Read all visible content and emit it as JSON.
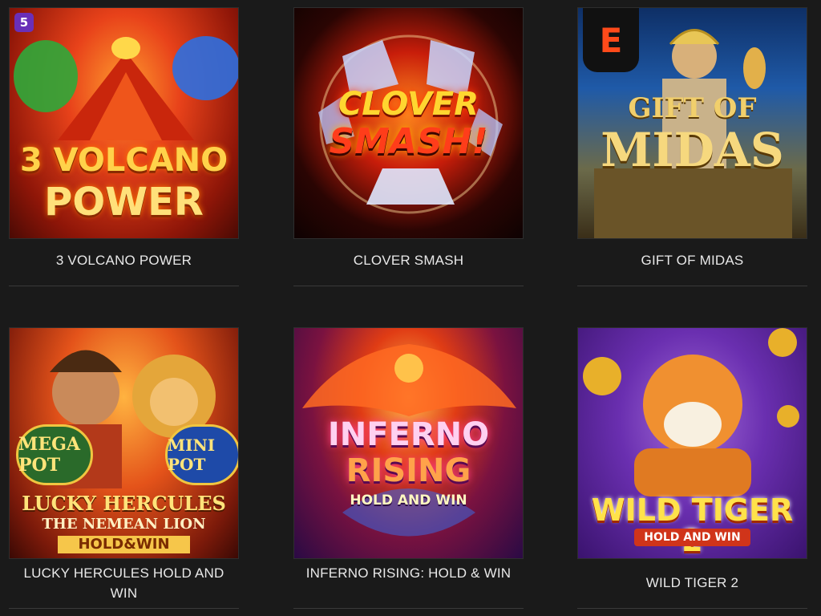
{
  "games": [
    {
      "id": "volcano",
      "label": "3 VOLCANO POWER",
      "art_lines": [
        "3 VOLCANO",
        "POWER"
      ],
      "provider_badge": "5",
      "accent": "#e8421a"
    },
    {
      "id": "clover",
      "label": "CLOVER SMASH",
      "art_lines": [
        "CLOVER",
        "SMASH!"
      ],
      "accent": "#c81d0a"
    },
    {
      "id": "midas",
      "label": "GIFT OF MIDAS",
      "art_lines": [
        "GIFT OF",
        "MIDAS"
      ],
      "provider_badge": "E",
      "accent": "#1f5aa8"
    },
    {
      "id": "hercules",
      "label": "LUCKY HERCULES HOLD AND WIN",
      "art_lines": [
        "LUCKY HERCULES",
        "THE NEMEAN LION",
        "HOLD&WIN"
      ],
      "badges": [
        "MEGA POT",
        "MINI POT"
      ],
      "accent": "#e4531a"
    },
    {
      "id": "inferno",
      "label": "INFERNO RISING: HOLD & WIN",
      "art_lines": [
        "INFERNO",
        "RISING",
        "HOLD AND WIN"
      ],
      "accent": "#7a1240"
    },
    {
      "id": "tiger",
      "label": "WILD TIGER 2",
      "art_lines": [
        "WILD TIGER 2",
        "HOLD AND WIN"
      ],
      "accent": "#6a2fb0"
    }
  ]
}
